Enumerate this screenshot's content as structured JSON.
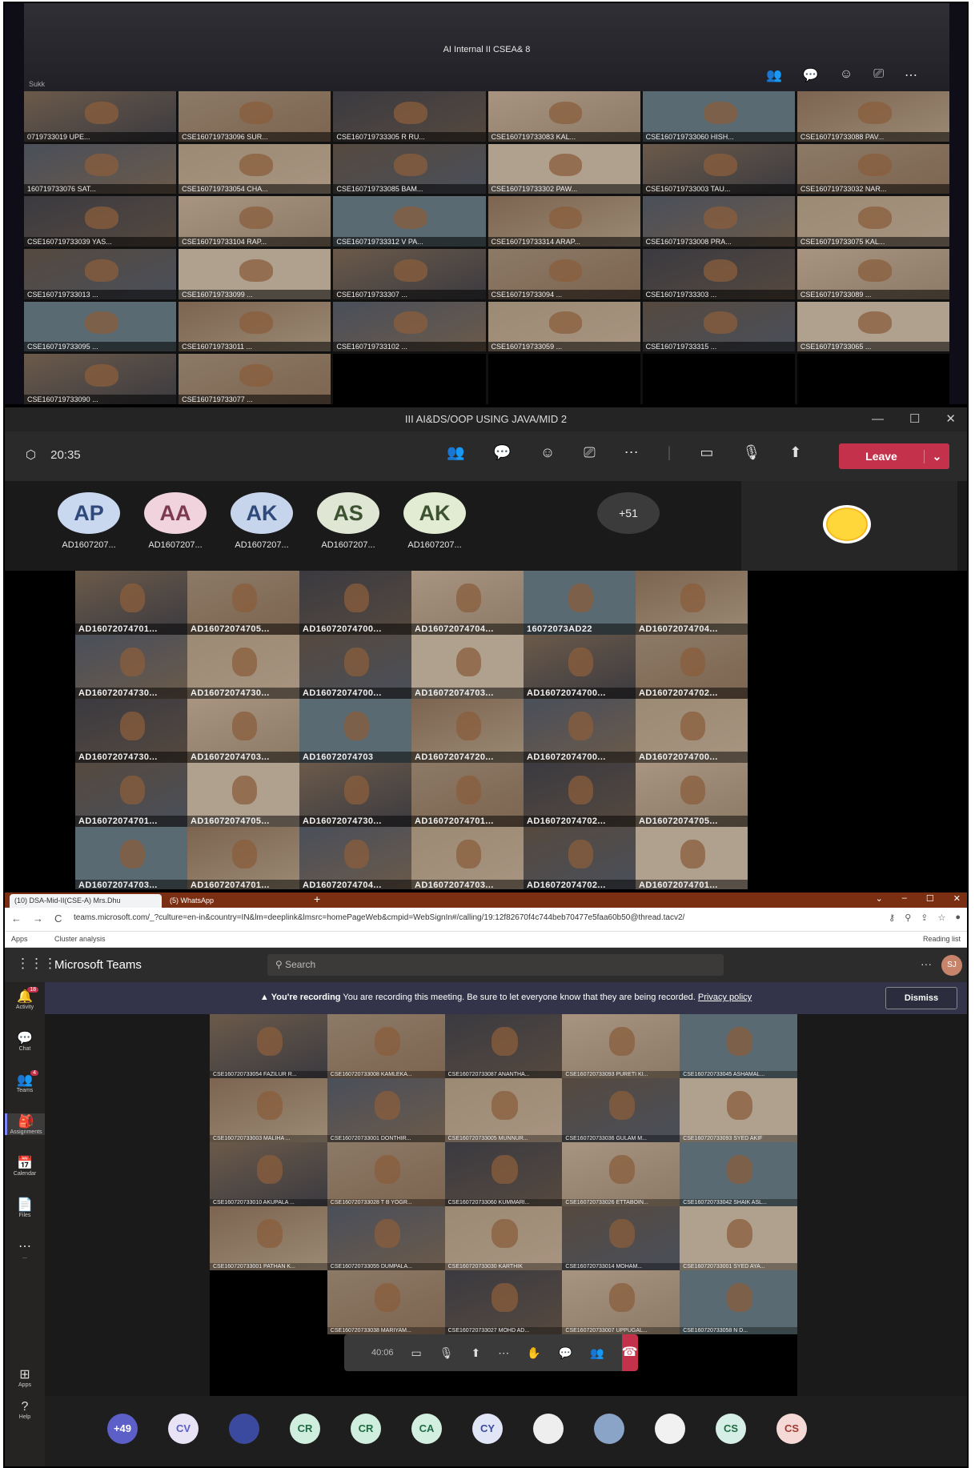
{
  "panel1": {
    "title": "AI Internal II CSEA& 8",
    "sidebar_name": "Sukk",
    "toolbar_icons": [
      "people-icon",
      "chat-icon",
      "react-icon",
      "share-icon",
      "more-icon"
    ],
    "tiles": [
      "0719733019 UPE...",
      "CSE160719733096 SUR...",
      "CSE160719733305 R RU...",
      "CSE160719733083 KAL...",
      "CSE160719733060 HISH...",
      "CSE160719733088 PAV...",
      "160719733076 SAT...",
      "CSE160719733054 CHA...",
      "CSE160719733085 BAM...",
      "CSE160719733302 PAW...",
      "CSE160719733003 TAU...",
      "CSE160719733032 NAR...",
      "CSE160719733039 YAS...",
      "CSE160719733104 RAP...",
      "CSE160719733312 V PA...",
      "CSE160719733314 ARAP...",
      "CSE160719733008 PRA...",
      "CSE160719733075 KAL...",
      "CSE160719733013 ...",
      "CSE160719733099 ...",
      "CSE160719733307 ...",
      "CSE160719733094 ...",
      "CSE160719733303 ...",
      "CSE160719733089 ...",
      "CSE160719733095 ...",
      "CSE160719733011 ...",
      "CSE160719733102 ...",
      "CSE160719733059 ...",
      "CSE160719733315 ...",
      "CSE160719733065 ...",
      "CSE160719733090 ...",
      "CSE160719733077 ...",
      "",
      "",
      "",
      ""
    ]
  },
  "panel2": {
    "title": "III AI&DS/OOP USING JAVA/MID 2",
    "time": "20:35",
    "leave_label": "Leave",
    "avatars": [
      {
        "initials": "AP",
        "name": "AD1607207...",
        "bg": "#c9d7ef",
        "fg": "#2f4a7a"
      },
      {
        "initials": "AA",
        "name": "AD1607207...",
        "bg": "#f1d3dd",
        "fg": "#7b3a4f"
      },
      {
        "initials": "AK",
        "name": "AD1607207...",
        "bg": "#c6d5ec",
        "fg": "#2f4a7a"
      },
      {
        "initials": "AS",
        "name": "AD1607207...",
        "bg": "#dfe6d3",
        "fg": "#3d5230"
      },
      {
        "initials": "AK",
        "name": "AD1607207...",
        "bg": "#e2ecd2",
        "fg": "#3d5230"
      }
    ],
    "more_count": "+51",
    "tiles": [
      "AD16072074701...",
      "AD16072074705...",
      "AD16072074700...",
      "AD16072074704...",
      "16072073AD22",
      "AD16072074704...",
      "AD16072074730...",
      "AD16072074730...",
      "AD16072074700...",
      "AD16072074703...",
      "AD16072074700...",
      "AD16072074702...",
      "AD16072074730...",
      "AD16072074703...",
      "AD16072074703",
      "AD16072074720...",
      "AD16072074700...",
      "AD16072074700...",
      "AD16072074701...",
      "AD16072074705...",
      "AD16072074730...",
      "AD16072074701...",
      "AD16072074702...",
      "AD16072074705...",
      "AD16072074703...",
      "AD16072074701...",
      "AD16072074704...",
      "AD16072074703...",
      "AD16072074702...",
      "AD16072074701..."
    ]
  },
  "panel3": {
    "tab1": "(10) DSA-Mid-II(CSE-A) Mrs.Dhu",
    "tab2": "(5) WhatsApp",
    "url": "teams.microsoft.com/_?culture=en-in&country=IN&lm=deeplink&lmsrc=homePageWeb&cmpid=WebSignIn#/calling/19:12f82670f4c744beb70477e5faa60b50@thread.tacv2/",
    "bookmarks": [
      "Apps",
      "Cluster analysis",
      "Reading list"
    ],
    "app_name": "Microsoft Teams",
    "search_placeholder": "Search",
    "rail": [
      {
        "label": "Activity",
        "badge": "18"
      },
      {
        "label": "Chat",
        "badge": ""
      },
      {
        "label": "Teams",
        "badge": "4"
      },
      {
        "label": "Assignments",
        "badge": ""
      },
      {
        "label": "Calendar",
        "badge": ""
      },
      {
        "label": "Files",
        "badge": ""
      },
      {
        "label": "...",
        "badge": ""
      },
      {
        "label": "Apps",
        "badge": ""
      },
      {
        "label": "Help",
        "badge": ""
      }
    ],
    "banner_bold": "You're recording",
    "banner_text": "You are recording this meeting. Be sure to let everyone know that they are being recorded.",
    "banner_link": "Privacy policy",
    "dismiss_label": "Dismiss",
    "call_time": "40:06",
    "tiles": [
      "CSE160720733054 FAZILUR R...",
      "CSE160720733008 KAMLEKA...",
      "CSE160720733087 ANANTHA...",
      "CSE160720733093 PURETI KI...",
      "CSE160720733045 ASHAMAL...",
      "CSE160720733003 MALIHA ...",
      "CSE160720733001 DONTHIR...",
      "CSE160720733005 MUNNUR...",
      "CSE160720733036 GULAM M...",
      "CSE160720733093 SYED AKIF",
      "CSE160720733010 AKUPALA ...",
      "CSE160720733028 T B YOGR...",
      "CSE160720733060 KUMMARI...",
      "CSE160720733026 ETTABOIN...",
      "CSE160720733042 SHAIK ASL...",
      "CSE160720733001 PATHAN K...",
      "CSE160720733055 DUMPALA...",
      "CSE160720733030 KARTHIK",
      "CSE160720733014 MOHAM...",
      "CSE160720733001 SYED AYA...",
      "",
      "CSE160720733038 MARIYAM...",
      "CSE160720733027 MOHD AD...",
      "CSE160720733007 UPPUGAL...",
      "CSE160720733058 N D..."
    ],
    "bottom_avatars": [
      {
        "initials": "+49",
        "bg": "#5b5fc7",
        "fg": "#ffffff"
      },
      {
        "initials": "CV",
        "bg": "#e8e3f5",
        "fg": "#5b5fc7"
      },
      {
        "initials": "",
        "bg": "#3b4a9e",
        "fg": "#ffffff"
      },
      {
        "initials": "CR",
        "bg": "#cfeedd",
        "fg": "#1e6b43"
      },
      {
        "initials": "CR",
        "bg": "#cfeedd",
        "fg": "#1e6b43"
      },
      {
        "initials": "CA",
        "bg": "#d3efe0",
        "fg": "#1e6b43"
      },
      {
        "initials": "CY",
        "bg": "#e1e6f7",
        "fg": "#3b4a9e"
      },
      {
        "initials": "",
        "bg": "#eeeeee",
        "fg": "#222222"
      },
      {
        "initials": "",
        "bg": "#8aa4c8",
        "fg": "#ffffff"
      },
      {
        "initials": "",
        "bg": "#f1f1f1",
        "fg": "#222222"
      },
      {
        "initials": "CS",
        "bg": "#d6efe6",
        "fg": "#1e6b43"
      },
      {
        "initials": "CS",
        "bg": "#f5d9d6",
        "fg": "#a33a30"
      }
    ]
  }
}
